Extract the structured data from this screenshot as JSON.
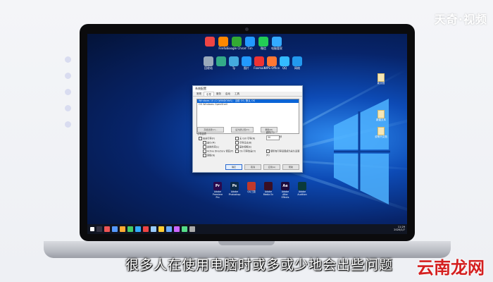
{
  "watermark_top": "天奇·视频",
  "watermark_bottom": "云南龙网",
  "subtitle": "很多人在使用电脑时或多或少地会出些问题",
  "desktop_icons_row1": [
    "",
    "Firefox",
    "Google Chrome",
    "Tim",
    "微信",
    "电脑管家"
  ],
  "desktop_icons_row2": [
    "回收站",
    "",
    "Ty",
    "图片",
    "Foxmail",
    "WPS Office",
    "QQ",
    "网络"
  ],
  "dialog": {
    "title": "系统配置",
    "tabs": [
      "常规",
      "引导",
      "服务",
      "启动",
      "工具"
    ],
    "os_entries": [
      "Windows 10 (C:\\WINDOWS) : 当前 OS; 默认 OS",
      "OS Windows OpenShell"
    ],
    "boot_buttons": [
      "高级选项(V)...",
      "设为默认值(D)",
      "删除(D)"
    ],
    "boot_options_label": "引导选项",
    "safe_boot": "安全引导(F)",
    "minimal": "最小(M)",
    "alt_shell": "其他外壳(L)",
    "ad_repair": "Active Directory 修复(P)",
    "network": "网络(N)",
    "no_gui": "无 GUI 引导(N)",
    "boot_log": "引导日志(B)",
    "base_video": "基本视频(E)",
    "os_boot_info": "OS 引导信息(O)",
    "timeout_label": "超时(T):",
    "timeout_value": "30",
    "timeout_unit": "秒",
    "make_permanent": "使所有引导设置成为永久设置(K)",
    "ok": "确定",
    "cancel": "取消",
    "apply": "应用(A)",
    "help": "帮助"
  },
  "dock_apps": [
    {
      "abbr": "Pr",
      "label": "Adobe Premiere Pro",
      "color": "#2a0a4e"
    },
    {
      "abbr": "Ps",
      "label": "Adobe Photoshop",
      "color": "#0b2a4a"
    },
    {
      "abbr": "",
      "label": "QQ三国",
      "color": "#c0392b"
    },
    {
      "abbr": "",
      "label": "Adobe Media En",
      "color": "#3a0f24"
    },
    {
      "abbr": "Ae",
      "label": "Adobe After Effects",
      "color": "#1d0a3c"
    },
    {
      "abbr": "",
      "label": "Adobe Audition",
      "color": "#0a3a3a"
    }
  ],
  "files_right": [
    "新文档",
    "新建文本",
    "说明书文档"
  ],
  "tray": {
    "time": "11:29",
    "date": "2020/1/7"
  }
}
